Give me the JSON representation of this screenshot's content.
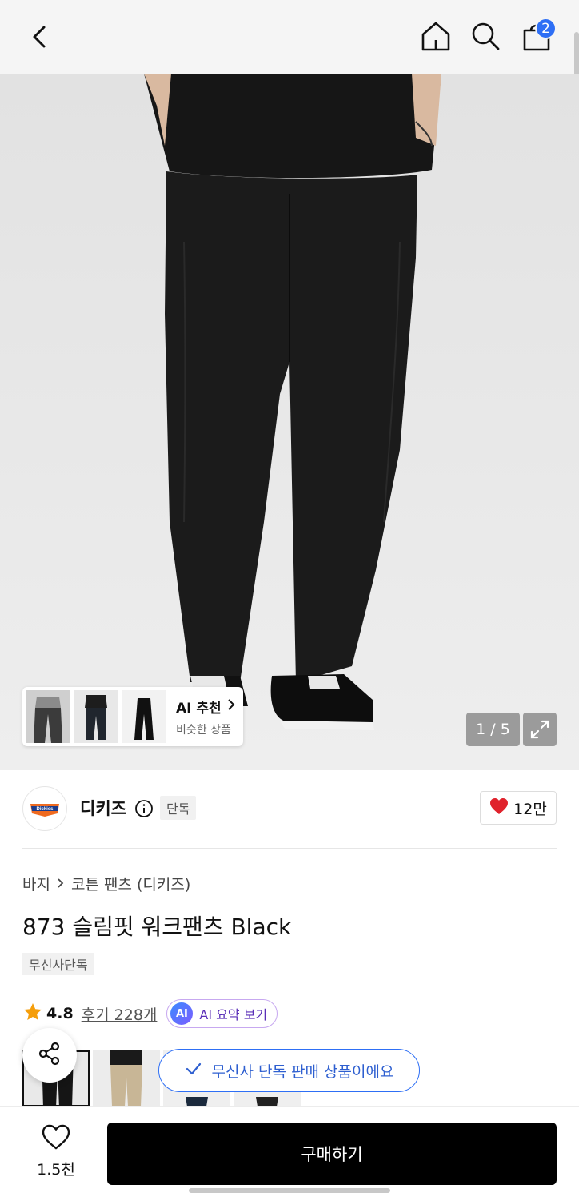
{
  "header": {
    "cart_count": "2"
  },
  "hero": {
    "image_counter": "1 / 5",
    "ai_reco_title": "AI 추천",
    "ai_reco_subtitle": "비슷한 상품"
  },
  "brand": {
    "name": "디키즈",
    "logo_text": "Dickies",
    "exclusive_label": "단독",
    "likes": "12만"
  },
  "product": {
    "breadcrumb": [
      "바지",
      "코튼 팬츠 (디키즈)"
    ],
    "title": "873 슬림핏 워크팬츠 Black",
    "tag": "무신사단독",
    "rating": "4.8",
    "review_link": "후기 228개",
    "ai_summary_icon": "AI",
    "ai_summary_label": "AI 요약 보기",
    "exclusive_notice": "무신사 단독 판매 상품이에요"
  },
  "bottom": {
    "wish_count": "1.5천",
    "buy_label": "구매하기"
  },
  "colors": {
    "accent_blue": "#2e6ff5",
    "heart_red": "#e0222c",
    "star_orange": "#f59e0b",
    "buy_bg": "#000000"
  }
}
